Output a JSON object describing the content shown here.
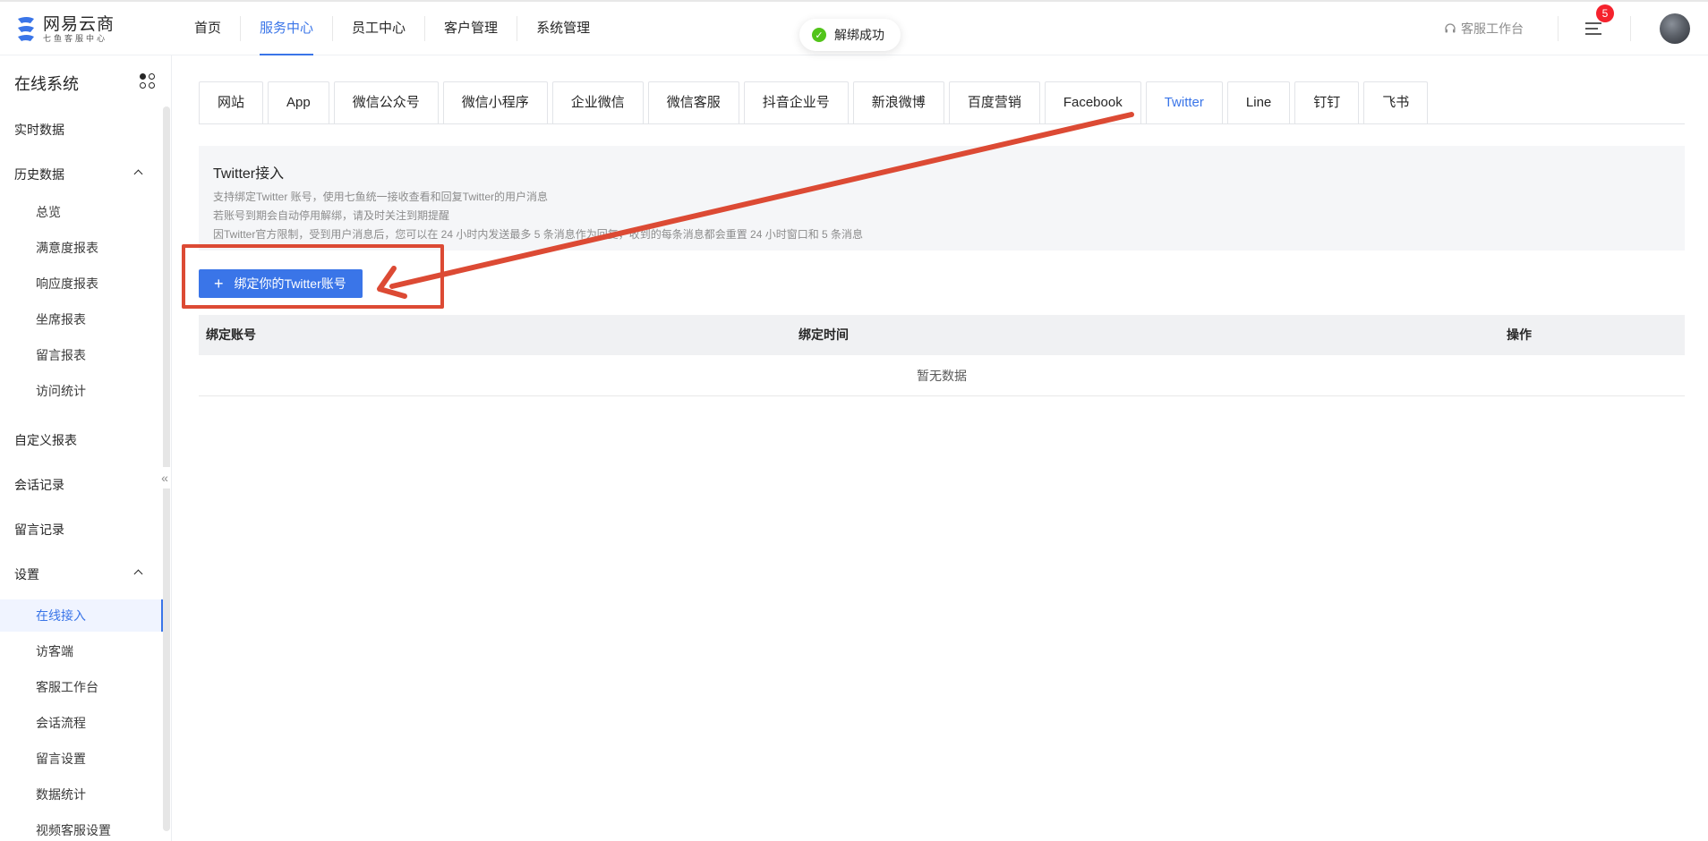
{
  "brand": {
    "title": "网易云商",
    "subtitle": "七鱼客服中心"
  },
  "nav": [
    {
      "label": "首页"
    },
    {
      "label": "服务中心",
      "active": true
    },
    {
      "label": "员工中心"
    },
    {
      "label": "客户管理"
    },
    {
      "label": "系统管理"
    }
  ],
  "toast": {
    "text": "解绑成功"
  },
  "topright": {
    "workbench": "客服工作台",
    "badge_count": "5"
  },
  "sidebar": {
    "title": "在线系统",
    "items": [
      {
        "label": "实时数据"
      },
      {
        "label": "历史数据"
      },
      {
        "label": "总览"
      },
      {
        "label": "满意度报表"
      },
      {
        "label": "响应度报表"
      },
      {
        "label": "坐席报表"
      },
      {
        "label": "留言报表"
      },
      {
        "label": "访问统计"
      },
      {
        "label": "自定义报表"
      },
      {
        "label": "会话记录"
      },
      {
        "label": "留言记录"
      },
      {
        "label": "设置"
      },
      {
        "label": "在线接入"
      },
      {
        "label": "访客端"
      },
      {
        "label": "客服工作台"
      },
      {
        "label": "会话流程"
      },
      {
        "label": "留言设置"
      },
      {
        "label": "数据统计"
      },
      {
        "label": "视频客服设置"
      }
    ]
  },
  "tabs": [
    {
      "label": "网站"
    },
    {
      "label": "App"
    },
    {
      "label": "微信公众号"
    },
    {
      "label": "微信小程序"
    },
    {
      "label": "企业微信"
    },
    {
      "label": "微信客服"
    },
    {
      "label": "抖音企业号"
    },
    {
      "label": "新浪微博"
    },
    {
      "label": "百度营销"
    },
    {
      "label": "Facebook"
    },
    {
      "label": "Twitter",
      "active": true
    },
    {
      "label": "Line"
    },
    {
      "label": "钉钉"
    },
    {
      "label": "飞书"
    }
  ],
  "info": {
    "title": "Twitter接入",
    "lines": [
      "支持绑定Twitter 账号，使用七鱼统一接收查看和回复Twitter的用户消息",
      "若账号到期会自动停用解绑，请及时关注到期提醒",
      "因Twitter官方限制，受到用户消息后，您可以在 24 小时内发送最多 5 条消息作为回复，收到的每条消息都会重置 24 小时窗口和 5 条消息"
    ]
  },
  "bind_button": {
    "label": "绑定你的Twitter账号"
  },
  "table": {
    "columns": [
      "绑定账号",
      "绑定时间",
      "操作"
    ],
    "empty_text": "暂无数据"
  },
  "colors": {
    "accent": "#3a75e8",
    "annotation": "#dc4a34",
    "success": "#52c41a",
    "badge": "#f5222d"
  }
}
